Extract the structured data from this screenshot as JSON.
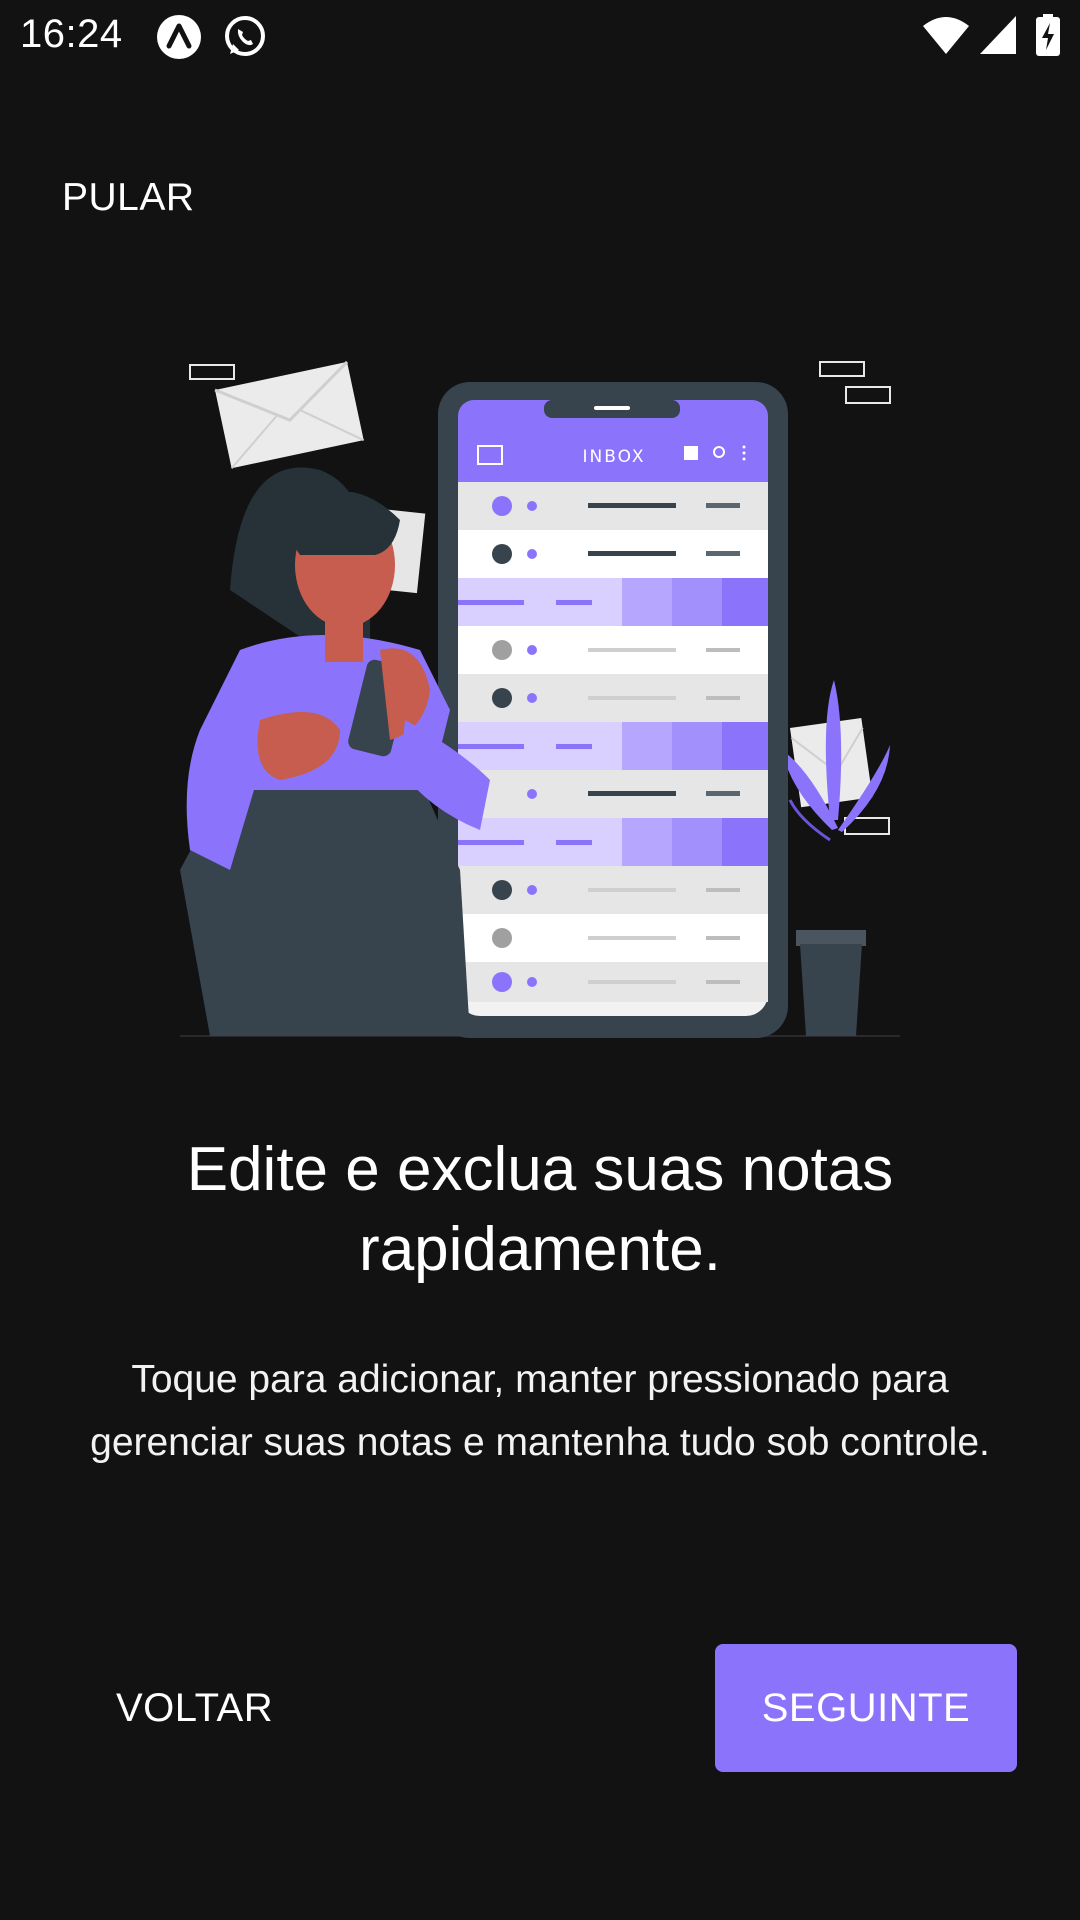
{
  "status_bar": {
    "time": "16:24",
    "notification_icons": [
      "arc-app-icon",
      "whatsapp-icon"
    ],
    "system_icons": [
      "wifi-icon",
      "cellular-signal-icon",
      "battery-charging-icon"
    ]
  },
  "onboarding": {
    "skip_label": "PULAR",
    "illustration": {
      "icon": "inbox-phone-illustration",
      "phone_screen_title": "INBOX"
    },
    "headline": "Edite e exclua suas notas rapidamente.",
    "description": "Toque para adicionar, manter pressionado para gerenciar suas notas e mantenha tudo sob controle.",
    "back_label": "VOLTAR",
    "next_label": "SEGUINTE"
  },
  "colors": {
    "background": "#121213",
    "accent": "#8b74fb",
    "text": "#ffffff"
  }
}
